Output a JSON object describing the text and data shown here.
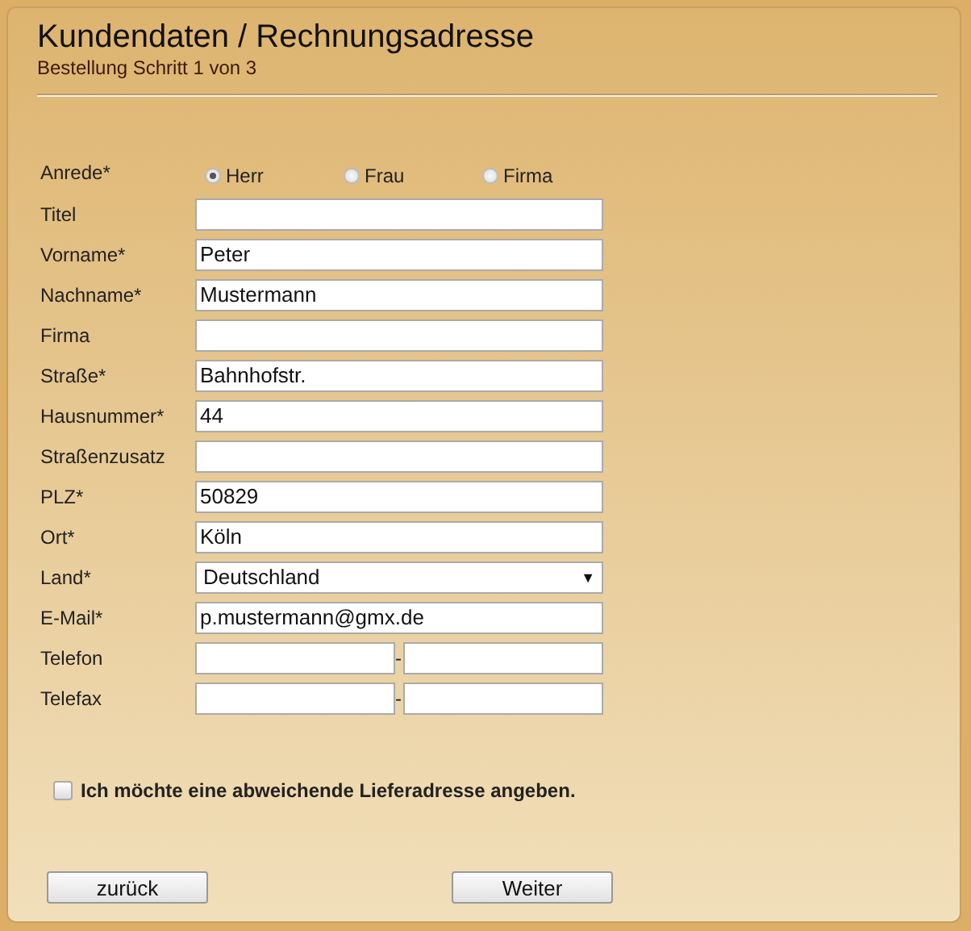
{
  "title": "Kundendaten / Rechnungsadresse",
  "subtitle": "Bestellung Schritt 1 von 3",
  "salutation": {
    "label": "Anrede*",
    "options": [
      {
        "label": "Herr",
        "selected": true
      },
      {
        "label": "Frau",
        "selected": false
      },
      {
        "label": "Firma",
        "selected": false
      }
    ]
  },
  "fields": [
    {
      "kind": "text",
      "label": "Titel"
    },
    {
      "kind": "text",
      "label": "Vorname*",
      "value": "Peter"
    },
    {
      "kind": "text",
      "label": "Nachname*",
      "value": "Mustermann"
    },
    {
      "kind": "text",
      "label": "Firma"
    },
    {
      "kind": "text",
      "label": "Straße*",
      "value": "Bahnhofstr."
    },
    {
      "kind": "text",
      "label": "Hausnummer*",
      "value": "44"
    },
    {
      "kind": "text",
      "label": "Straßenzusatz"
    },
    {
      "kind": "text",
      "label": "PLZ*",
      "value": "50829"
    },
    {
      "kind": "text",
      "label": "Ort*",
      "value": "Köln"
    },
    {
      "kind": "select",
      "label": "Land*",
      "value": "Deutschland",
      "arrow": "▼"
    },
    {
      "kind": "text",
      "label": "E-Mail*",
      "value": "p.mustermann@gmx.de"
    },
    {
      "kind": "phone",
      "label": "Telefon",
      "separator": "-"
    },
    {
      "kind": "phone",
      "label": "Telefax",
      "separator": "-"
    }
  ],
  "delivery_checkbox": {
    "label": "Ich möchte eine abweichende Lieferadresse angeben.",
    "checked": false
  },
  "buttons": [
    {
      "label": "zurück"
    },
    {
      "label": "Weiter"
    }
  ]
}
